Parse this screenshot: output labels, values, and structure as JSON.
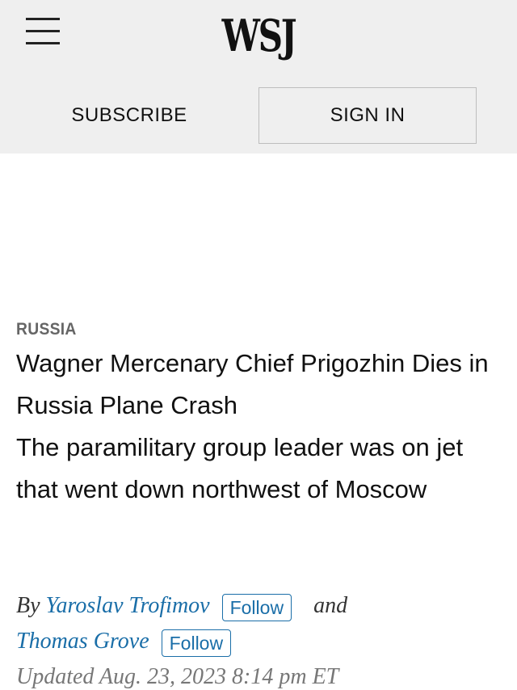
{
  "header": {
    "logo": "WSJ",
    "subscribe_label": "SUBSCRIBE",
    "signin_label": "SIGN IN"
  },
  "article": {
    "section": "RUSSIA",
    "headline": "Wagner Mercenary Chief Prigozhin Dies in Russia Plane Crash",
    "dek": "The paramilitary group leader was on jet that went down northwest of Moscow",
    "byline": {
      "prefix": "By",
      "authors": [
        {
          "name": "Yaroslav Trofimov",
          "follow_label": "Follow"
        },
        {
          "name": "Thomas Grove",
          "follow_label": "Follow"
        }
      ],
      "conjunction": "and"
    },
    "updated": "Updated Aug. 23, 2023 8:14 pm ET"
  },
  "colors": {
    "header_bg": "#efefef",
    "link": "#1a6ea8",
    "section_label": "#666666"
  },
  "icons": {
    "menu": "hamburger-menu-icon"
  }
}
